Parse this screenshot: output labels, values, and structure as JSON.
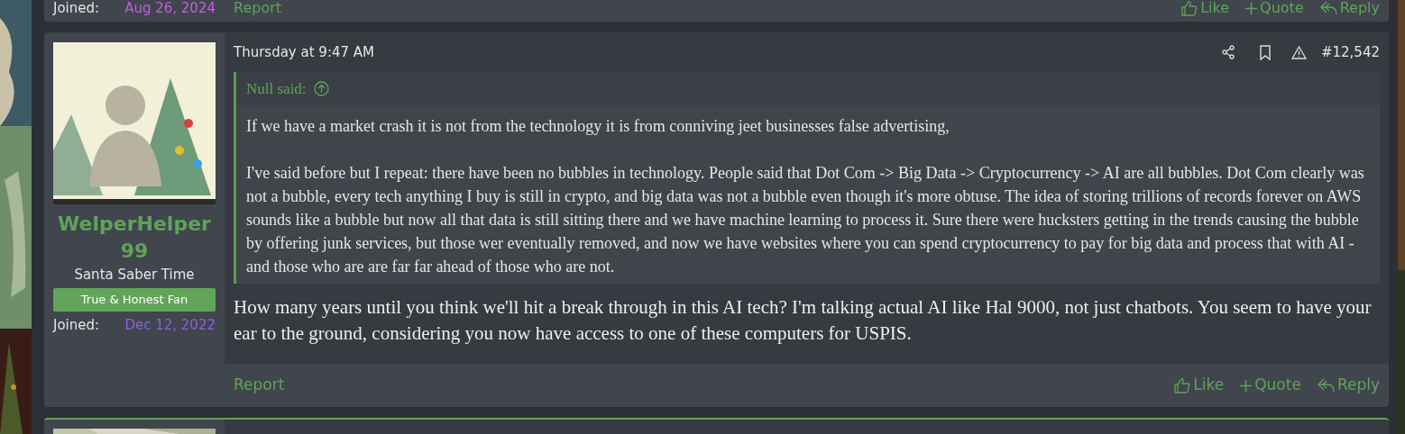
{
  "previous_post": {
    "author": {
      "joined_label": "Joined:",
      "joined_date": "Aug 26, 2024"
    },
    "actions": [
      {
        "kind": "report",
        "label": "Report"
      },
      {
        "kind": "like",
        "label": "Like"
      },
      {
        "kind": "quote",
        "label": "Quote"
      },
      {
        "kind": "reply",
        "label": "Reply"
      }
    ]
  },
  "post": {
    "author": {
      "name": "WelperHelper99",
      "title": "Santa Saber Time",
      "banner": "True & Honest Fan",
      "joined_label": "Joined:",
      "joined_date": "Dec 12, 2022"
    },
    "timestamp": "Thursday at 9:47 AM",
    "post_number": "#12,542",
    "quote": {
      "author": "Null said:",
      "paragraphs": [
        "If we have a market crash it is not from the technology it is from conniving jeet businesses false advertising,",
        "I've said before but I repeat: there have been no bubbles in technology. People said that Dot Com -> Big Data -> Cryptocurrency -> AI are all bubbles. Dot Com clearly was not a bubble, every tech anything I buy is still in crypto, and big data was not a bubble even though it's more obtuse. The idea of storing trillions of records forever on AWS sounds like a bubble but now all that data is still sitting there and we have machine learning to process it. Sure there were hucksters getting in the trends causing the bubble by offering junk services, but those wer eventually removed, and now we have websites where you can spend cryptocurrency to pay for big data and process that with AI - and those who are are far far ahead of those who are not."
      ]
    },
    "body": "How many years until you think we'll hit a break through in this AI tech? I'm talking actual AI like Hal 9000, not just chatbots. You seem to have your ear to the ground, considering you now have access to one of these computers for USPIS.",
    "actions": [
      {
        "kind": "report",
        "label": "Report"
      },
      {
        "kind": "like",
        "label": "Like"
      },
      {
        "kind": "quote",
        "label": "Quote"
      },
      {
        "kind": "reply",
        "label": "Reply"
      }
    ]
  }
}
